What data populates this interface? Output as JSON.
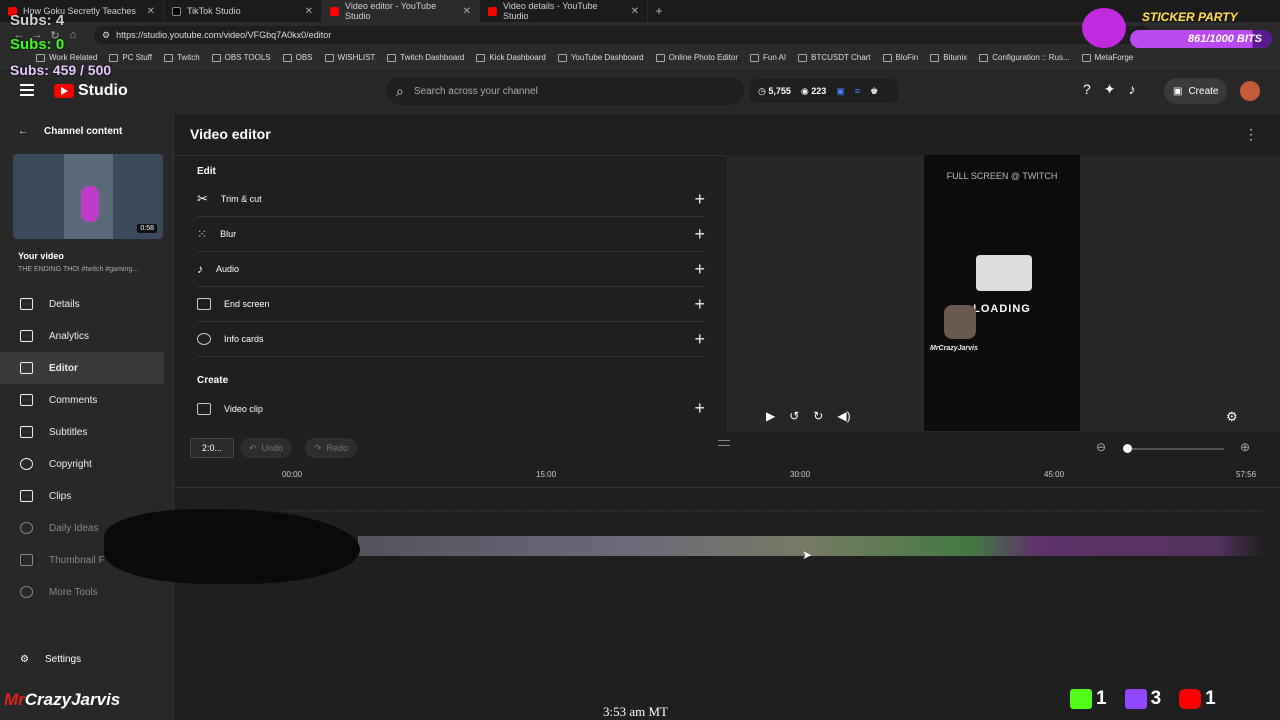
{
  "browser": {
    "tabs": [
      {
        "label": "How Goku Secretly Teaches"
      },
      {
        "label": "TikTok Studio"
      },
      {
        "label": "Video editor - YouTube Studio"
      },
      {
        "label": "Video details - YouTube Studio"
      }
    ],
    "url": "https://studio.youtube.com/video/VFGbq7A0kx0/editor",
    "bookmarks": [
      "Work Related",
      "PC Stuff",
      "Twitch",
      "OBS TOOLS",
      "OBS",
      "WISHLIST",
      "Twitch Dashboard",
      "Kick Dashboard",
      "YouTube Dashboard",
      "Online Photo Editor",
      "Fun AI",
      "BTCUSDT Chart",
      "BloFin",
      "Bitunix",
      "Configuration :: Rus...",
      "MetaForge"
    ]
  },
  "header": {
    "logo_text": "Studio",
    "search_placeholder": "Search across your channel",
    "stat_views": "5,755",
    "stat_subs": "223",
    "create_label": "Create"
  },
  "sidebar": {
    "back_label": "Channel content",
    "thumb_duration": "0:58",
    "your_video": "Your video",
    "video_title": "THE ENDING THO! #twitch #gaming...",
    "items": [
      {
        "label": "Details"
      },
      {
        "label": "Analytics"
      },
      {
        "label": "Editor"
      },
      {
        "label": "Comments"
      },
      {
        "label": "Subtitles"
      },
      {
        "label": "Copyright"
      },
      {
        "label": "Clips"
      },
      {
        "label": "Daily Ideas"
      },
      {
        "label": "Thumbnail F"
      },
      {
        "label": "More Tools"
      }
    ],
    "settings_label": "Settings"
  },
  "editor": {
    "title": "Video editor",
    "edit_heading": "Edit",
    "tools": [
      {
        "label": "Trim & cut"
      },
      {
        "label": "Blur"
      },
      {
        "label": "Audio"
      },
      {
        "label": "End screen"
      },
      {
        "label": "Info cards"
      }
    ],
    "create_heading": "Create",
    "create_tools": [
      {
        "label": "Video clip"
      }
    ],
    "preview_label": "FULL SCREEN @ TWITCH",
    "preview_loading": "LOADING",
    "preview_name": "MrCrazyJarvis",
    "zoom_value": "2:0...",
    "undo_label": "Undo",
    "redo_label": "Redo",
    "ruler_ticks": [
      "00:00",
      "15:00",
      "30:00",
      "45:00",
      "57:56"
    ]
  },
  "overlay": {
    "subs_line1": "Subs: 4",
    "subs_line2": "Subs: 0",
    "subs_line3": "Subs: 459 / 500",
    "sticker_title": "STICKER PARTY",
    "sticker_progress": "861/1000 BITS",
    "sticker_fraction": 0.861,
    "watermark_a": "Mr",
    "watermark_b": "CrazyJarvis",
    "clock": "3:53 am MT",
    "kick_count": "1",
    "twitch_count": "3",
    "youtube_count": "1"
  },
  "colors": {
    "accent_red": "#ff0000",
    "subs_green": "#39ff14",
    "sticker_purple": "#8a2ad0",
    "kick_green": "#53fc18",
    "twitch_purple": "#9146ff"
  }
}
